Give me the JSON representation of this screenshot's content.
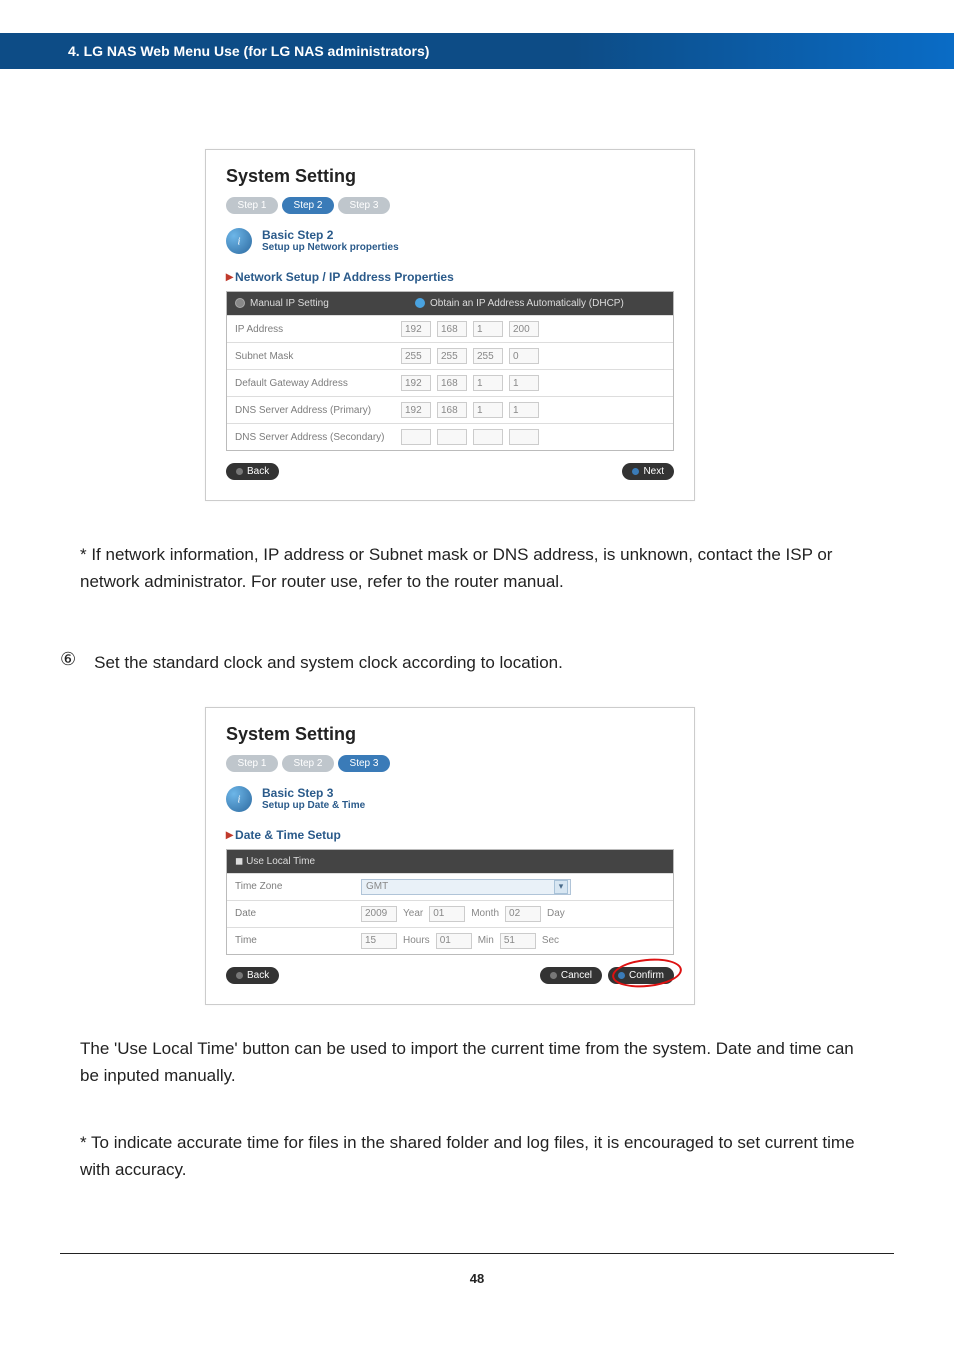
{
  "header": {
    "title": "4. LG NAS Web Menu Use (for LG NAS administrators)"
  },
  "screenshot1": {
    "title": "System Setting",
    "steps": [
      "Step 1",
      "Step 2",
      "Step 3"
    ],
    "activeStep": 1,
    "basicTitle": "Basic Step 2",
    "basicSub": "Setup up Network properties",
    "section": "Network Setup / IP Address Properties",
    "hdr1": "Manual IP Setting",
    "hdr2": "Obtain an IP Address Automatically (DHCP)",
    "rows": [
      {
        "label": "IP Address",
        "v": [
          "192",
          "168",
          "1",
          "200"
        ]
      },
      {
        "label": "Subnet Mask",
        "v": [
          "255",
          "255",
          "255",
          "0"
        ]
      },
      {
        "label": "Default Gateway Address",
        "v": [
          "192",
          "168",
          "1",
          "1"
        ]
      },
      {
        "label": "DNS Server Address (Primary)",
        "v": [
          "192",
          "168",
          "1",
          "1"
        ]
      },
      {
        "label": "DNS Server Address (Secondary)",
        "v": [
          "",
          "",
          "",
          ""
        ]
      }
    ],
    "back": "Back",
    "next": "Next"
  },
  "para1": "* If network information, IP address or Subnet mask or DNS address, is unknown, contact the ISP or network administrator. For router use, refer to the router manual.",
  "step6num": "⑥",
  "step6text": "Set the standard clock and system clock according to location.",
  "screenshot2": {
    "title": "System Setting",
    "steps": [
      "Step 1",
      "Step 2",
      "Step 3"
    ],
    "activeStep": 2,
    "basicTitle": "Basic Step 3",
    "basicSub": "Setup up Date & Time",
    "section": "Date & Time Setup",
    "useLocal": "Use Local Time",
    "tzLabel": "Time Zone",
    "tzValue": "GMT",
    "dateLabel": "Date",
    "date": {
      "year": "2009",
      "yearL": "Year",
      "month": "01",
      "monthL": "Month",
      "day": "02",
      "dayL": "Day"
    },
    "timeLabel": "Time",
    "time": {
      "h": "15",
      "hL": "Hours",
      "m": "01",
      "mL": "Min",
      "s": "51",
      "sL": "Sec"
    },
    "back": "Back",
    "cancel": "Cancel",
    "confirm": "Confirm"
  },
  "para2a": "The 'Use Local Time' button can be used to import the current time from the system. Date and time can be inputed manually.",
  "para2b": "* To indicate accurate time for files in the shared folder and log files, it is encouraged to set current time with accuracy.",
  "pageNumber": "48"
}
